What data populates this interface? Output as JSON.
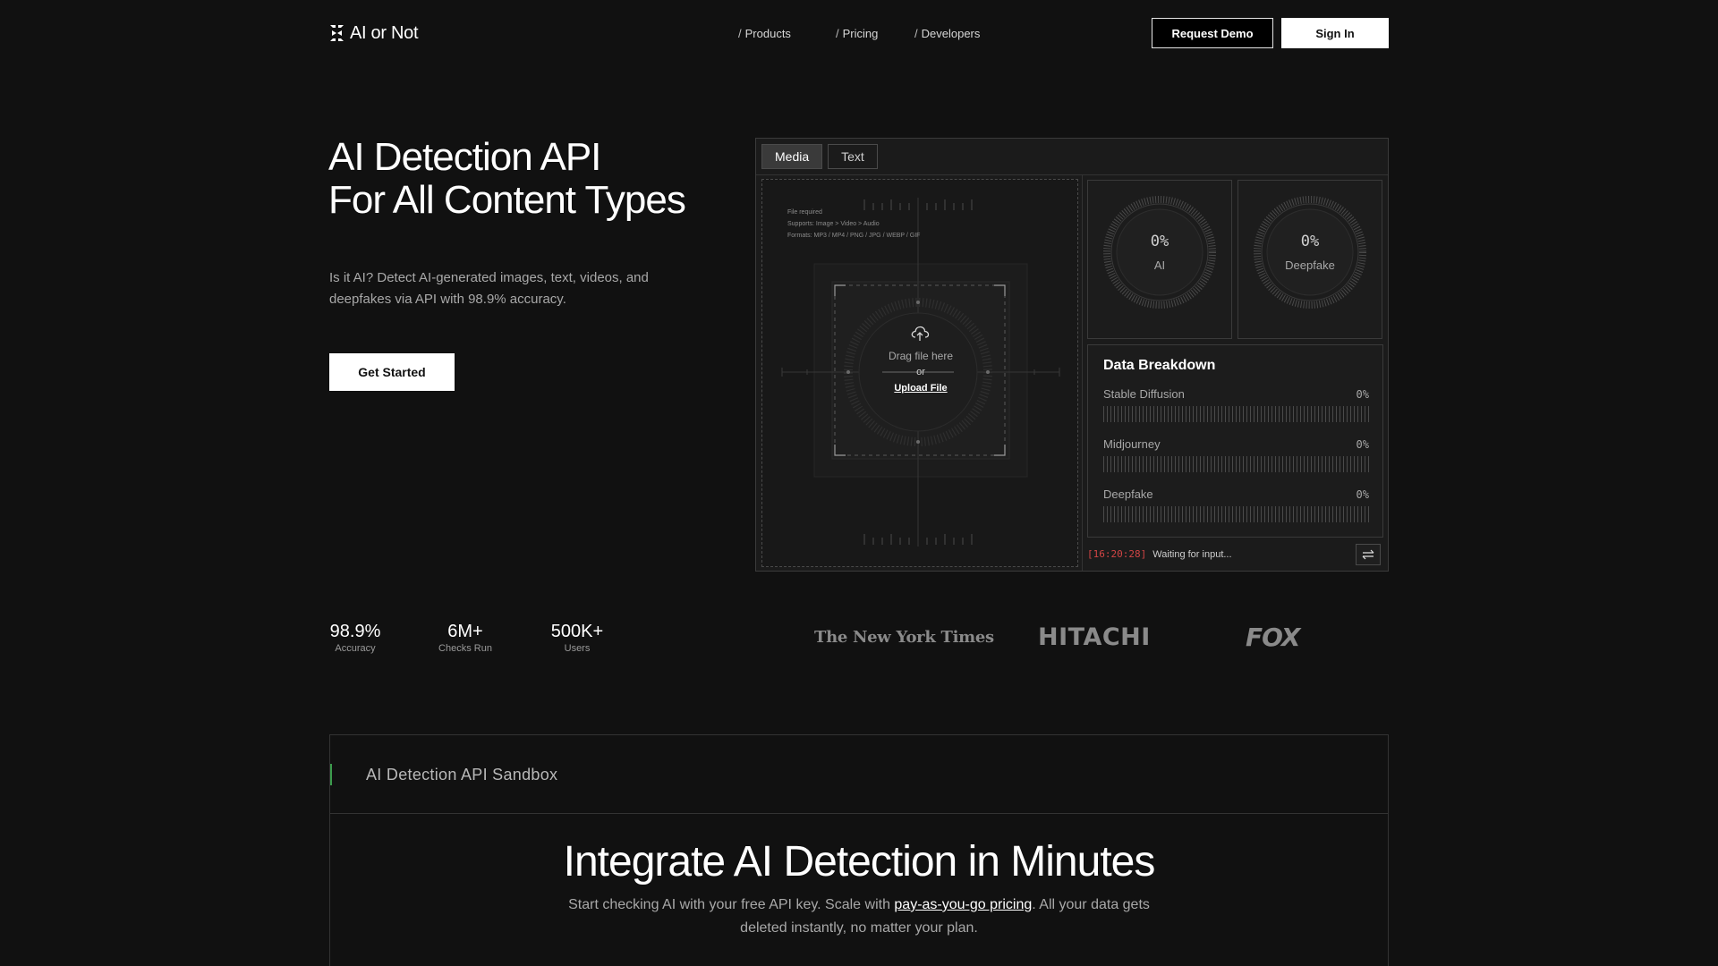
{
  "header": {
    "logo_text": "AI or Not",
    "nav": [
      {
        "slash": "/",
        "label": "Products"
      },
      {
        "slash": "/",
        "label": "Pricing"
      },
      {
        "slash": "/",
        "label": "Developers"
      }
    ],
    "request_demo_label": "Request Demo",
    "sign_in_label": "Sign In"
  },
  "hero": {
    "title_line1": "AI Detection API",
    "title_line2": "For All Content Types",
    "desc_line1": "Is it AI? Detect AI-generated images, text, videos, and",
    "desc_line2": "deepfakes via API with 98.9% accuracy.",
    "cta_label": "Get Started"
  },
  "stats": [
    {
      "value": "98.9%",
      "label": "Accuracy"
    },
    {
      "value": "6M+",
      "label": "Checks Run"
    },
    {
      "value": "500K+",
      "label": "Users"
    }
  ],
  "press": [
    {
      "name": "The New York Times"
    },
    {
      "name": "HITACHI"
    },
    {
      "name": "FOX"
    }
  ],
  "widget": {
    "tabs": [
      {
        "label": "Media",
        "active": true
      },
      {
        "label": "Text",
        "active": false
      }
    ],
    "upload": {
      "meta_required": "File required",
      "meta_supports": "Supports: Image > Video > Audio",
      "meta_formats": "Formats: MP3 / MP4 / PNG / JPG / WEBP / GIF",
      "drag_text": "Drag file here",
      "or_text": "or",
      "upload_link": "Upload File"
    },
    "gauges": [
      {
        "value": "0%",
        "label": "AI"
      },
      {
        "value": "0%",
        "label": "Deepfake"
      }
    ],
    "breakdown": {
      "title": "Data Breakdown",
      "rows": [
        {
          "name": "Stable Diffusion",
          "value": "0%",
          "level": 0
        },
        {
          "name": "Midjourney",
          "value": "0%",
          "level": 0
        },
        {
          "name": "Deepfake",
          "value": "0%",
          "level": 0
        }
      ]
    },
    "status": {
      "timestamp": "[16:20:28]",
      "text": "Waiting for input..."
    },
    "settings_icon": "sliders-icon"
  },
  "sandbox": {
    "label": "AI Detection API Sandbox",
    "heading": "Integrate AI Detection in Minutes",
    "desc_part1": "Start checking AI with your free API key. Scale with ",
    "desc_link": "pay-as-you-go pricing",
    "desc_part2": ". All your data gets",
    "desc_line2": "deleted instantly, no matter your plan."
  },
  "colors": {
    "background": "#111111",
    "accent_green": "#3c9b4c",
    "timestamp_red": "#d24545"
  }
}
